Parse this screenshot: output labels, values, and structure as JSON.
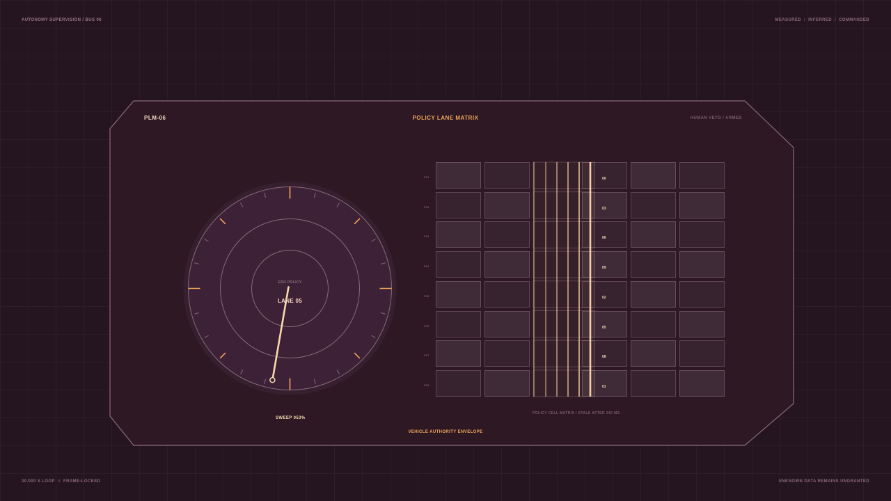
{
  "corners": {
    "top_left": "AUTONOMY SUPERVISION / BUS 06",
    "top_right": [
      "MEASURED",
      "INFERRED",
      "COMMANDED"
    ],
    "bottom_left": [
      "30.000 S LOOP",
      "FRAME-LOCKED"
    ],
    "bottom_left_sep": "//",
    "bottom_right": "UNKNOWN DATA REMAINS UNGRANTED",
    "top_right_sep": "/"
  },
  "panel": {
    "id": "PLM-06",
    "title": "POLICY LANE MATRIX",
    "veto_status": "HUMAN VETO / ARMED",
    "footer_title": "VEHICLE AUTHORITY ENVELOPE"
  },
  "dial": {
    "small_label": "ERO POLICY",
    "lane_label": "LANE 05",
    "sweep_readout": "SWEEP 053%",
    "sweep_fraction": 0.53,
    "colors": {
      "accent": "#f0a85a",
      "needle": "#f7d9ae",
      "face": "#3a1f33"
    }
  },
  "matrix": {
    "caption": "POLICY CELL MATRIX / STALE AFTER 240 MS",
    "row_labels": [
      "P01",
      "P02",
      "P03",
      "P04",
      "P05",
      "P06",
      "P07",
      "P08"
    ],
    "cell_values": [
      "00",
      "03",
      "06",
      "09",
      "02",
      "05",
      "08",
      "01"
    ],
    "columns": 6,
    "highlight_column": 2,
    "colors": {
      "scan_line": "#f7d0a0",
      "cell_border": "#8a6a78"
    }
  }
}
